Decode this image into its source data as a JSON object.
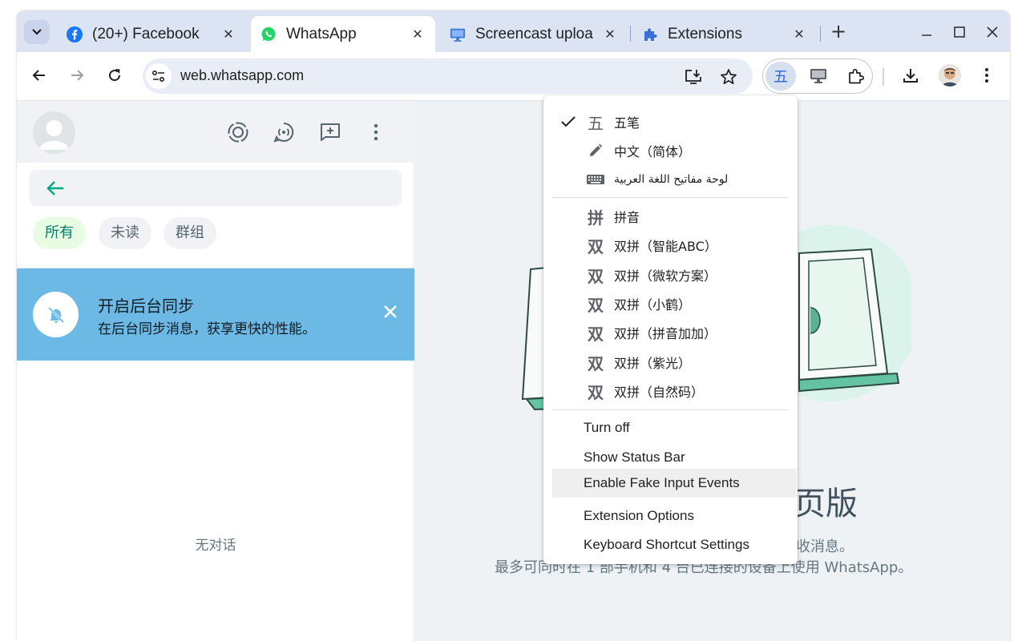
{
  "tabs": [
    {
      "title": "(20+) Facebook",
      "icon": "facebook-icon",
      "close": "✕"
    },
    {
      "title": "WhatsApp",
      "icon": "whatsapp-icon",
      "close": "✕"
    },
    {
      "title": "Screencast uploa",
      "icon": "screencast-icon",
      "close": "✕"
    },
    {
      "title": "Extensions",
      "icon": "puzzle-icon",
      "close": "✕"
    }
  ],
  "toolbar": {
    "url": "web.whatsapp.com",
    "ime_badge": "五"
  },
  "whatsapp": {
    "chips": [
      "所有",
      "未读",
      "群组"
    ],
    "banner_title": "开启后台同步",
    "banner_subtitle": "在后台同步消息，获享更快的性能。",
    "empty_text": "无对话",
    "main_title": "页版",
    "main_line1": "收消息。",
    "main_line2": "最多可同时在 1 部手机和 4 台已连接的设备上使用 WhatsApp。"
  },
  "menu": {
    "input_methods": [
      {
        "glyph": "五",
        "label": "五笔",
        "checked": true
      },
      {
        "glyph": "pencil-icon",
        "label": "中文（简体）",
        "checked": false
      },
      {
        "glyph": "keyboard-icon",
        "label": "لوحة مفاتيح اللغة العربية",
        "checked": false
      }
    ],
    "pinyin_methods": [
      {
        "glyph": "拼",
        "label": "拼音"
      },
      {
        "glyph": "双",
        "label": "双拼（智能ABC）"
      },
      {
        "glyph": "双",
        "label": "双拼（微软方案）"
      },
      {
        "glyph": "双",
        "label": "双拼（小鹤）"
      },
      {
        "glyph": "双",
        "label": "双拼（拼音加加）"
      },
      {
        "glyph": "双",
        "label": "双拼（紫光）"
      },
      {
        "glyph": "双",
        "label": "双拼（自然码）"
      }
    ],
    "actions": [
      "Turn off",
      "Show Status Bar",
      "Enable Fake Input Events",
      "Extension Options",
      "Keyboard Shortcut Settings"
    ]
  },
  "colors": {
    "whatsapp_green": "#00a884",
    "banner_blue": "#6cb9e5",
    "facebook_blue": "#1877f2",
    "ime_blue": "#2f63d7"
  }
}
